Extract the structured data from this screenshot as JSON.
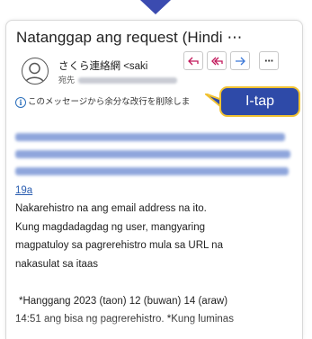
{
  "email": {
    "subject": "Natanggap ang request (Hindi ⋯",
    "sender": "さくら連絡網 <saki",
    "to_label": "宛先",
    "info_banner": "このメッセージから余分な改行を削除しま",
    "link_suffix": "19a",
    "body_lines": [
      "Nakarehistro na ang email address na ito.",
      "Kung magdadagdag ng user, mangyaring",
      "magpatuloy sa pagrerehistro mula sa URL na",
      "nakasulat sa itaas",
      "",
      "*Hanggang 2023 (taon) 12 (buwan) 14 (araw)",
      "14:51 ang bisa ng pagrerehistro.  *Kung luminas"
    ]
  },
  "actions": {
    "reply": "⮌",
    "reply_all": "⮌",
    "forward": "→",
    "more": "···"
  },
  "callout": {
    "text": "I-tap"
  },
  "colors": {
    "callout_bg": "#2e4aa8",
    "callout_border": "#f1c232",
    "arrow": "#3b4bb0",
    "link": "#2a5db0"
  },
  "icons": [
    "down-arrow-icon",
    "avatar-icon",
    "reply-icon",
    "reply-all-icon",
    "forward-icon",
    "more-icon",
    "info-icon"
  ]
}
